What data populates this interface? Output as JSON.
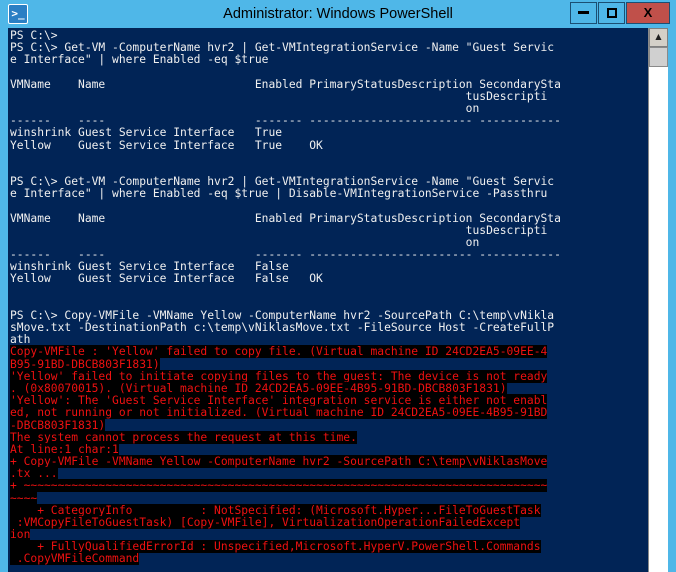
{
  "window": {
    "title": "Administrator: Windows PowerShell",
    "icon": "powershell-icon",
    "icon_glyph": ">_",
    "controls": {
      "minimize_label": "",
      "maximize_label": "",
      "close_label": "X"
    },
    "colors": {
      "titlebar": "#4fb7e8",
      "console_background": "#012456",
      "console_foreground": "#f0f0f0",
      "error_foreground": "#ee1111",
      "error_background": "#000000",
      "close_button": "#c0504a"
    }
  },
  "scrollbar": {
    "up_arrow_glyph": "▲",
    "orientation": "vertical",
    "thumb_position": "top"
  },
  "console": {
    "prompt": "PS C:\\>",
    "lines": [
      {
        "type": "normal",
        "text": "PS C:\\>"
      },
      {
        "type": "normal",
        "text": "PS C:\\> Get-VM -ComputerName hvr2 | Get-VMIntegrationService -Name \"Guest Servic"
      },
      {
        "type": "normal",
        "text": "e Interface\" | where Enabled -eq $true"
      },
      {
        "type": "normal",
        "text": ""
      },
      {
        "type": "normal",
        "text": "VMName    Name                      Enabled PrimaryStatusDescription SecondarySta"
      },
      {
        "type": "normal",
        "text": "                                                                   tusDescripti"
      },
      {
        "type": "normal",
        "text": "                                                                   on"
      },
      {
        "type": "normal",
        "text": "------    ----                      ------- ------------------------ ------------"
      },
      {
        "type": "normal",
        "text": "winshrink Guest Service Interface   True"
      },
      {
        "type": "normal",
        "text": "Yellow    Guest Service Interface   True    OK"
      },
      {
        "type": "normal",
        "text": ""
      },
      {
        "type": "normal",
        "text": ""
      },
      {
        "type": "normal",
        "text": "PS C:\\> Get-VM -ComputerName hvr2 | Get-VMIntegrationService -Name \"Guest Servic"
      },
      {
        "type": "normal",
        "text": "e Interface\" | where Enabled -eq $true | Disable-VMIntegrationService -Passthru"
      },
      {
        "type": "normal",
        "text": ""
      },
      {
        "type": "normal",
        "text": "VMName    Name                      Enabled PrimaryStatusDescription SecondarySta"
      },
      {
        "type": "normal",
        "text": "                                                                   tusDescripti"
      },
      {
        "type": "normal",
        "text": "                                                                   on"
      },
      {
        "type": "normal",
        "text": "------    ----                      ------- ------------------------ ------------"
      },
      {
        "type": "normal",
        "text": "winshrink Guest Service Interface   False"
      },
      {
        "type": "normal",
        "text": "Yellow    Guest Service Interface   False   OK"
      },
      {
        "type": "normal",
        "text": ""
      },
      {
        "type": "normal",
        "text": ""
      },
      {
        "type": "normal",
        "text": "PS C:\\> Copy-VMFile -VMName Yellow -ComputerName hvr2 -SourcePath C:\\temp\\vNikla"
      },
      {
        "type": "normal",
        "text": "sMove.txt -DestinationPath c:\\temp\\vNiklasMove.txt -FileSource Host -CreateFullP"
      },
      {
        "type": "normal",
        "text": "ath"
      },
      {
        "type": "error",
        "text": "Copy-VMFile : 'Yellow' failed to copy file. (Virtual machine ID 24CD2EA5-09EE-4"
      },
      {
        "type": "error",
        "text": "B95-91BD-DBCB803F1831)"
      },
      {
        "type": "error",
        "text": "'Yellow' failed to initiate copying files to the guest: The device is not ready"
      },
      {
        "type": "error",
        "text": ". (0x80070015). (Virtual machine ID 24CD2EA5-09EE-4B95-91BD-DBCB803F1831)"
      },
      {
        "type": "error",
        "text": "'Yellow': The 'Guest Service Interface' integration service is either not enabl"
      },
      {
        "type": "error",
        "text": "ed, not running or not initialized. (Virtual machine ID 24CD2EA5-09EE-4B95-91BD"
      },
      {
        "type": "error",
        "text": "-DBCB803F1831)"
      },
      {
        "type": "error",
        "text": "The system cannot process the request at this time."
      },
      {
        "type": "error",
        "text": "At line:1 char:1"
      },
      {
        "type": "error",
        "text": "+ Copy-VMFile -VMName Yellow -ComputerName hvr2 -SourcePath C:\\temp\\vNiklasMove"
      },
      {
        "type": "error",
        "text": ".tx ..."
      },
      {
        "type": "error",
        "text": "+ ~~~~~~~~~~~~~~~~~~~~~~~~~~~~~~~~~~~~~~~~~~~~~~~~~~~~~~~~~~~~~~~~~~~~~~~~~~~~~"
      },
      {
        "type": "error",
        "text": "~~~~"
      },
      {
        "type": "error",
        "text": "    + CategoryInfo          : NotSpecified: (Microsoft.Hyper...FileToGuestTask"
      },
      {
        "type": "error",
        "text": " :VMCopyFileToGuestTask) [Copy-VMFile], VirtualizationOperationFailedExcept"
      },
      {
        "type": "error",
        "text": "ion"
      },
      {
        "type": "error",
        "text": "    + FullyQualifiedErrorId : Unspecified,Microsoft.HyperV.PowerShell.Commands"
      },
      {
        "type": "error",
        "text": " .CopyVMFileCommand"
      },
      {
        "type": "normal",
        "text": ""
      }
    ]
  }
}
